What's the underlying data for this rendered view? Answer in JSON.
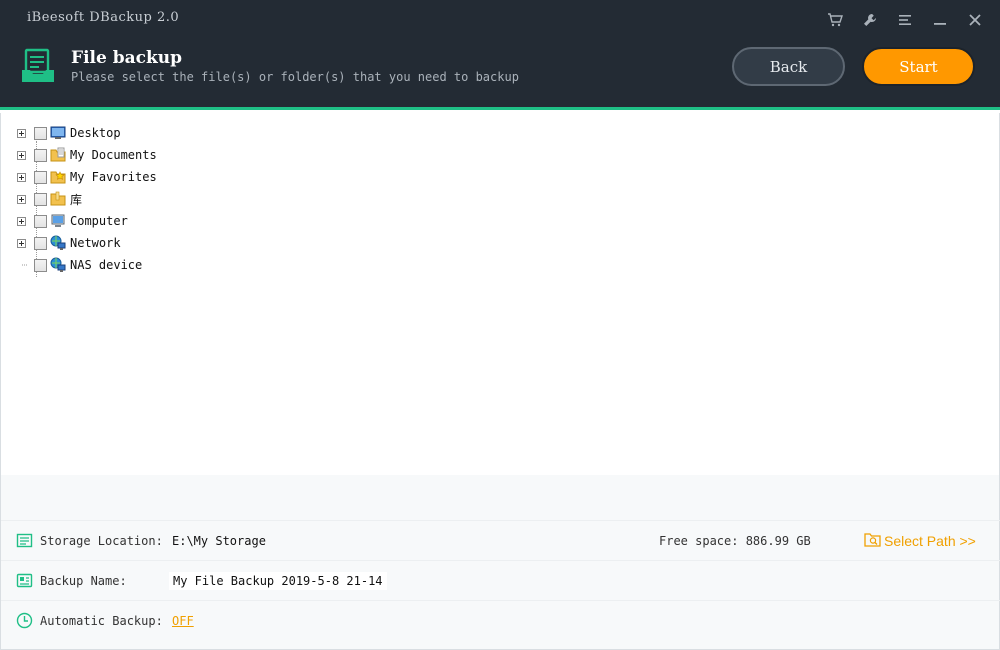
{
  "window": {
    "title": "iBeesoft DBackup 2.0",
    "icons": [
      "cart-icon",
      "wrench-icon",
      "menu-icon",
      "minimize-icon",
      "close-icon"
    ]
  },
  "header": {
    "title": "File backup",
    "subtitle": "Please select the file(s) or folder(s) that you need to backup",
    "back_label": "Back",
    "start_label": "Start"
  },
  "tree": {
    "items": [
      {
        "label": "Desktop",
        "icon": "desktop-icon",
        "expandable": true
      },
      {
        "label": "My Documents",
        "icon": "documents-folder-icon",
        "expandable": true
      },
      {
        "label": "My Favorites",
        "icon": "favorites-folder-icon",
        "expandable": true
      },
      {
        "label": "库",
        "icon": "library-folder-icon",
        "expandable": true
      },
      {
        "label": "Computer",
        "icon": "computer-icon",
        "expandable": true
      },
      {
        "label": "Network",
        "icon": "network-icon",
        "expandable": true
      },
      {
        "label": "NAS device",
        "icon": "nas-icon",
        "expandable": false
      }
    ]
  },
  "bottom": {
    "storage_label": "Storage Location:",
    "storage_value": "E:\\My Storage",
    "free_space": "Free space: 886.99 GB",
    "select_path": "Select Path >>",
    "name_label": "Backup Name:",
    "name_value": "My File Backup 2019-5-8 21-14",
    "auto_label": "Automatic Backup:",
    "auto_value": "OFF"
  },
  "colors": {
    "header_bg": "#232b34",
    "accent_green": "#1fbf86",
    "start_orange": "#ff9800",
    "link_orange": "#f0a000"
  }
}
